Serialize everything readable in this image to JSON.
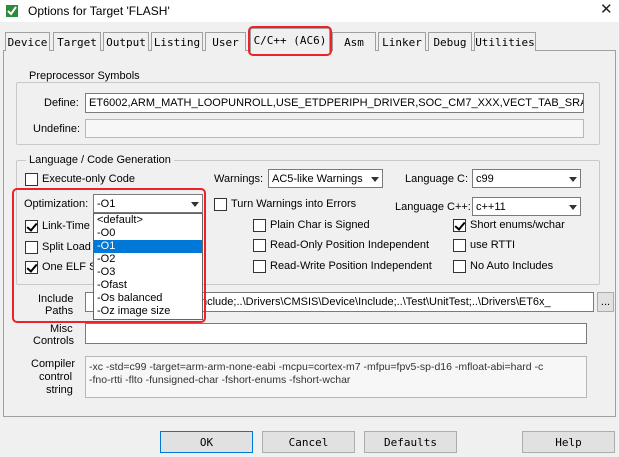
{
  "window": {
    "title": "Options for Target 'FLASH'",
    "close_glyph": "✕"
  },
  "tabs": [
    {
      "label": "Device"
    },
    {
      "label": "Target"
    },
    {
      "label": "Output"
    },
    {
      "label": "Listing"
    },
    {
      "label": "User"
    },
    {
      "label": "C/C++ (AC6)"
    },
    {
      "label": "Asm"
    },
    {
      "label": "Linker"
    },
    {
      "label": "Debug"
    },
    {
      "label": "Utilities"
    }
  ],
  "preprocessor": {
    "title": "Preprocessor Symbols",
    "define_label": "Define:",
    "define_value": "ET6002,ARM_MATH_LOOPUNROLL,USE_ETDPERIPH_DRIVER,SOC_CM7_XXX,VECT_TAB_SRAM",
    "undefine_label": "Undefine:",
    "undefine_value": ""
  },
  "codegen": {
    "title": "Language / Code Generation",
    "execute_only_label": "Execute-only Code",
    "warnings_label": "Warnings:",
    "warnings_value": "AC5-like Warnings",
    "language_c_label": "Language C:",
    "language_c_value": "c99",
    "optimization_label": "Optimization:",
    "optimization_value": "-O1",
    "turn_warnings_label": "Turn Warnings into Errors",
    "language_cpp_label": "Language C++:",
    "language_cpp_value": "c++11",
    "link_time_label": "Link-Time O",
    "plain_char_label": "Plain Char is Signed",
    "short_enums_label": "Short enums/wchar",
    "split_load_label": "Split Load a",
    "ropi_label": "Read-Only Position Independent",
    "rtti_label": "use RTTI",
    "one_elf_label": "One ELF S",
    "rwpi_label": "Read-Write Position Independent",
    "no_auto_includes_label": "No Auto Includes",
    "optimization_options": [
      "<default>",
      "-O0",
      "-O1",
      "-O2",
      "-O3",
      "-Ofast",
      "-Os balanced",
      "-Oz image size"
    ],
    "optimization_selected_index": 2
  },
  "include_paths": {
    "label_line1": "Include",
    "label_line2": "Paths",
    "value": "nclude;..\\Drivers\\CMSIS\\Device\\Include;..\\Test\\UnitTest;..\\Drivers\\ET6x_",
    "browse_label": "..."
  },
  "misc": {
    "label_line1": "Misc",
    "label_line2": "Controls",
    "value": ""
  },
  "compiler_string": {
    "label_line1": "Compiler",
    "label_line2": "control",
    "label_line3": "string",
    "line1": "-xc -std=c99 -target=arm-arm-none-eabi -mcpu=cortex-m7 -mfpu=fpv5-sp-d16 -mfloat-abi=hard -c",
    "line2": "-fno-rtti -flto -funsigned-char -fshort-enums -fshort-wchar"
  },
  "buttons": {
    "ok": "OK",
    "cancel": "Cancel",
    "defaults": "Defaults",
    "help": "Help"
  },
  "colors": {
    "highlight_red": "#e8232a",
    "selection_blue": "#0078d7"
  }
}
